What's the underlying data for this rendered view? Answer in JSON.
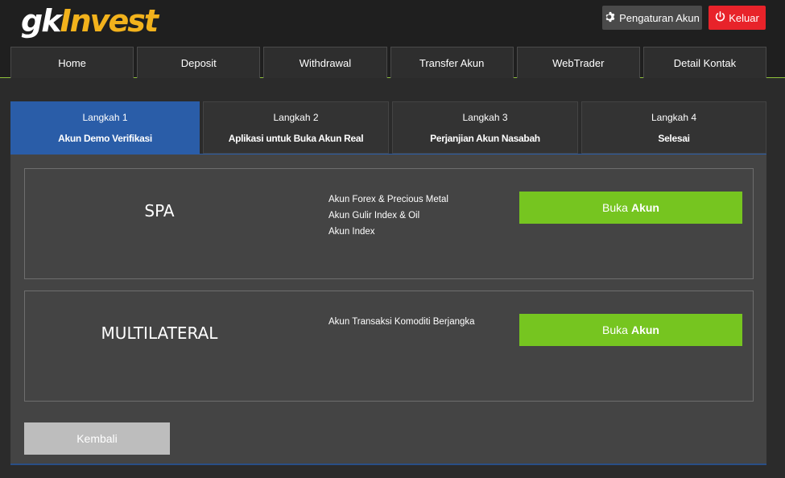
{
  "brand": {
    "logo_part1": "gk",
    "logo_part2": "Invest",
    "accent": "#f2b21c"
  },
  "header": {
    "settings_label": "Pengaturan Akun",
    "logout_label": "Keluar"
  },
  "nav": {
    "items": [
      {
        "label": "Home"
      },
      {
        "label": "Deposit"
      },
      {
        "label": "Withdrawal"
      },
      {
        "label": "Transfer Akun"
      },
      {
        "label": "WebTrader"
      },
      {
        "label": "Detail Kontak"
      }
    ]
  },
  "steps": [
    {
      "title": "Langkah 1",
      "subtitle": "Akun Demo Verifikasi",
      "active": true
    },
    {
      "title": "Langkah 2",
      "subtitle": "Aplikasi untuk Buka Akun Real",
      "active": false
    },
    {
      "title": "Langkah 3",
      "subtitle": "Perjanjian Akun Nasabah",
      "active": false
    },
    {
      "title": "Langkah 4",
      "subtitle": "Selesai",
      "active": false
    }
  ],
  "accounts": [
    {
      "name": "SPA",
      "features": [
        "Akun Forex & Precious Metal",
        "Akun Gulir Index & Oil",
        "Akun Index"
      ],
      "button_prefix": "Buka",
      "button_bold": "Akun"
    },
    {
      "name": "MULTILATERAL",
      "features": [
        "Akun Transaksi Komoditi Berjangka"
      ],
      "button_prefix": "Buka",
      "button_bold": "Akun"
    }
  ],
  "back_label": "Kembali",
  "colors": {
    "active_step": "#2a5da8",
    "open_button": "#76c520",
    "logout": "#e8232a",
    "settings": "#4a4a4a"
  }
}
